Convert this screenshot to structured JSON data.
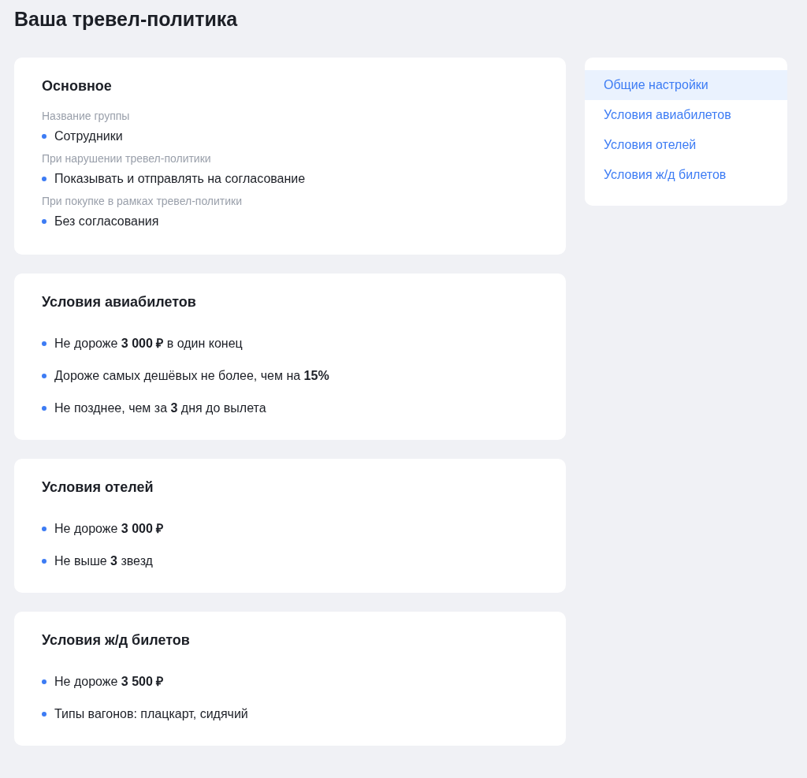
{
  "page_title": "Ваша тревел-политика",
  "sections": [
    {
      "title": "Основное",
      "items": [
        {
          "label": "Название группы",
          "text": "Сотрудники"
        },
        {
          "label": "При нарушении тревел-политики",
          "text": "Показывать и отправлять на согласование"
        },
        {
          "label": "При покупке в рамках тревел-политики",
          "text": "Без согласования"
        }
      ]
    },
    {
      "title": "Условия авиабилетов",
      "items": [
        {
          "text": "Не дороже **3 000 ₽** в один конец"
        },
        {
          "text": "Дороже самых дешёвых не более, чем на **15%**"
        },
        {
          "text": "Не позднее, чем за **3** дня до вылета"
        }
      ]
    },
    {
      "title": "Условия отелей",
      "items": [
        {
          "text": "Не дороже **3 000 ₽**"
        },
        {
          "text": "Не выше **3** звезд"
        }
      ]
    },
    {
      "title": "Условия ж/д билетов",
      "items": [
        {
          "text": "Не дороже **3 500 ₽**"
        },
        {
          "text": "Типы вагонов: плацкарт, сидячий"
        }
      ]
    }
  ],
  "nav": [
    {
      "label": "Общие настройки",
      "selected": true
    },
    {
      "label": "Условия авиабилетов",
      "selected": false
    },
    {
      "label": "Условия отелей",
      "selected": false
    },
    {
      "label": "Условия ж/д билетов",
      "selected": false
    }
  ]
}
